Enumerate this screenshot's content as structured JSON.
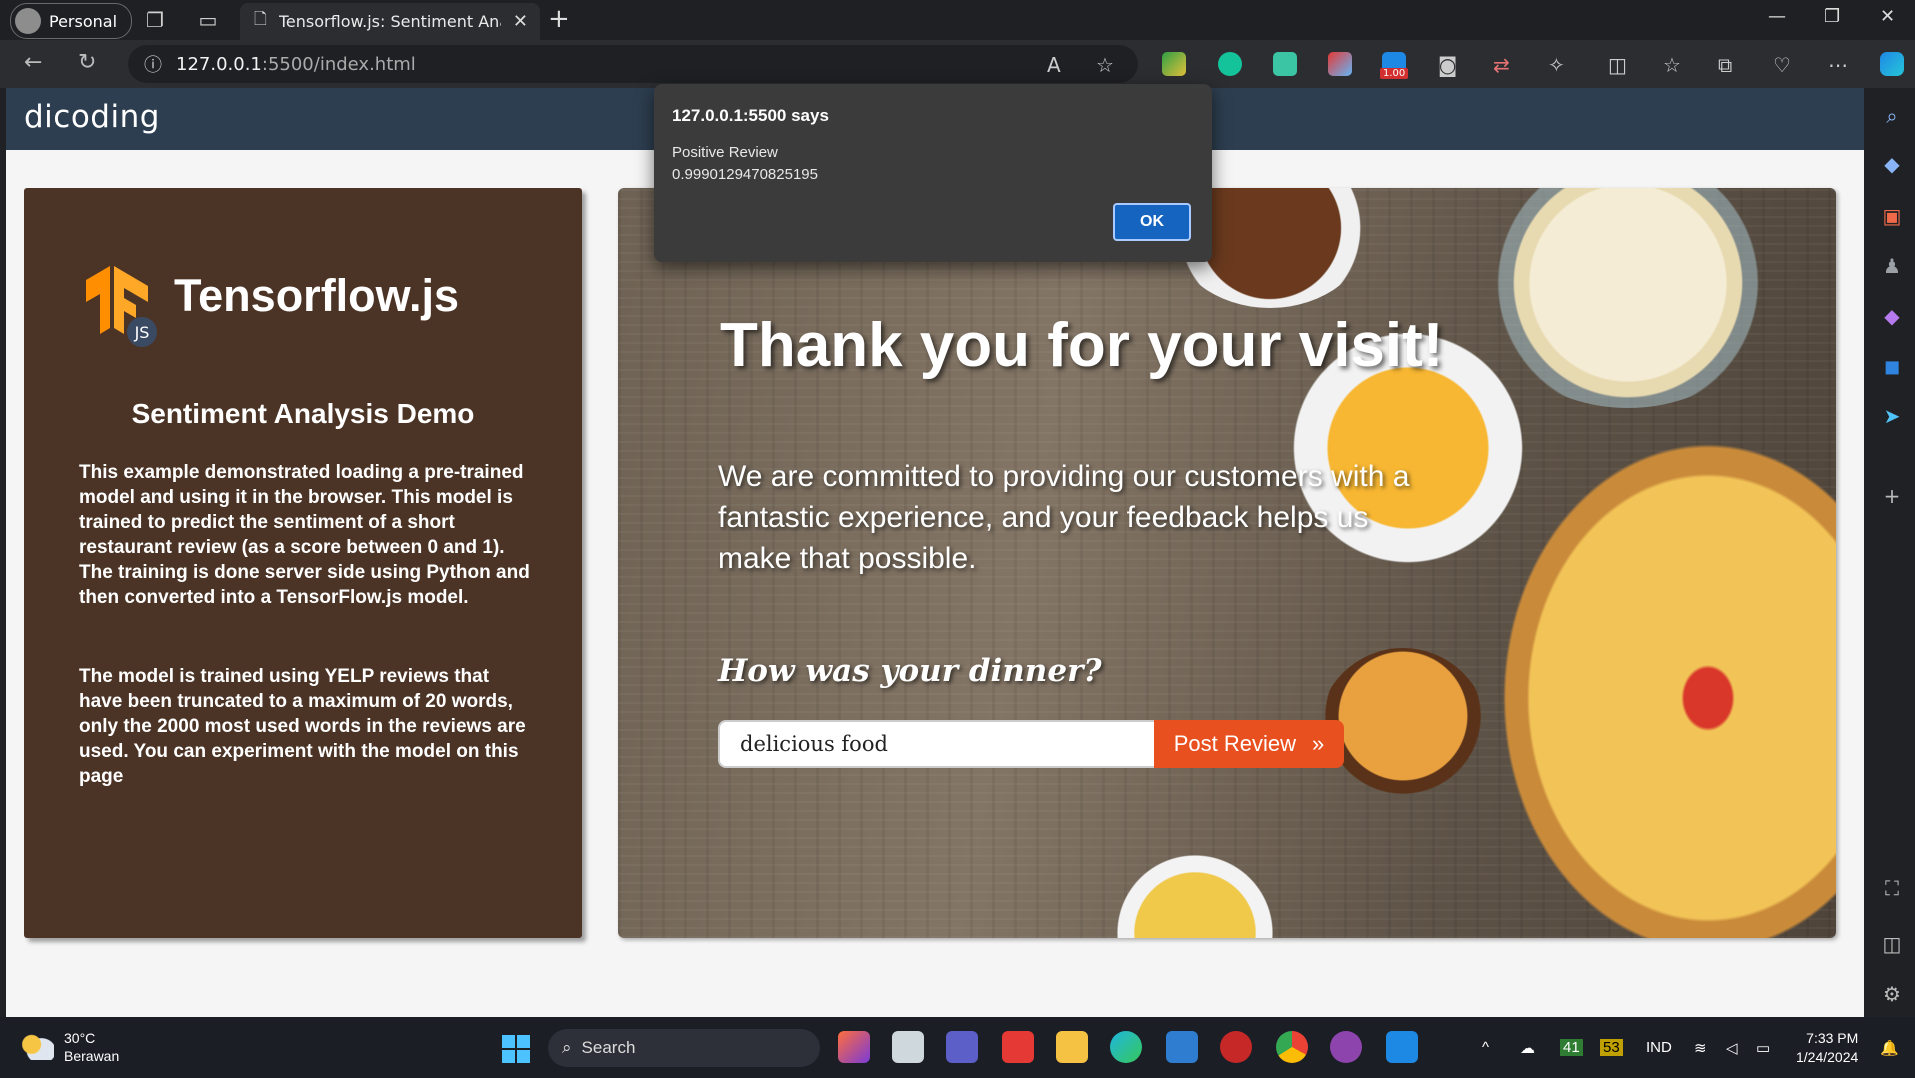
{
  "browser": {
    "profile_label": "Personal",
    "tab_title": "Tensorflow.js: Sentiment Analysis",
    "url_host": "127.0.0.1",
    "url_path": ":5500/index.html",
    "ext_badge": "1.00"
  },
  "site": {
    "logo_text": "dicoding",
    "left": {
      "brand_title": "Tensorflow.js",
      "tf_badge": "JS",
      "demo_title": "Sentiment Analysis Demo",
      "paragraph_1": "This example demonstrated loading a pre-trained model and using it in the browser. This model is trained to predict the sentiment of a short restaurant review (as a score between 0 and 1). The training is done server side using Python and then converted into a TensorFlow.js model.",
      "paragraph_2": "The model is trained using YELP reviews that have been truncated to a maximum of 20 words, only the 2000 most used words in the reviews are used. You can experiment with the model on this page"
    },
    "hero": {
      "heading": "Thank you for your visit!",
      "text": "We are committed to providing our customers with a fantastic experience, and your feedback helps us make that possible.",
      "question": "How was your dinner?",
      "input_value": "delicious food",
      "button_label": "Post Review",
      "button_arrow": "»"
    }
  },
  "alert": {
    "heading": "127.0.0.1:5500 says",
    "line_1": "Positive Review",
    "line_2": "0.9990129470825195",
    "ok_label": "OK"
  },
  "taskbar": {
    "temperature": "30°C",
    "condition": "Berawan",
    "search_label": "Search",
    "tray_num_1": "41",
    "tray_num_2": "53",
    "language": "IND",
    "time": "7:33 PM",
    "date": "1/24/2024"
  },
  "colors": {
    "nav_bg": "#2d3e50",
    "left_card_bg": "#4b3426",
    "button_orange": "#e8501f",
    "ok_blue": "#1565c0"
  }
}
